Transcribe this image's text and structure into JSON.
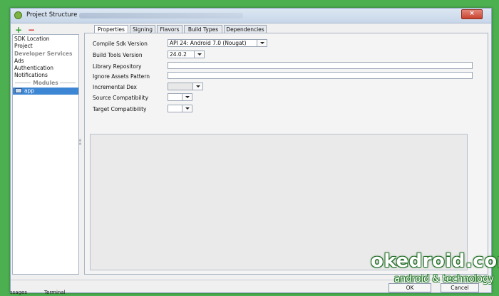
{
  "window": {
    "title": "Project Structure",
    "close_symbol": "×"
  },
  "toolbar": {
    "add_symbol": "+",
    "remove_symbol": "−"
  },
  "sidebar": {
    "items": [
      {
        "label": "SDK Location"
      },
      {
        "label": "Project"
      }
    ],
    "developer_services_header": "Developer Services",
    "developer_services": [
      {
        "label": "Ads"
      },
      {
        "label": "Authentication"
      },
      {
        "label": "Notifications"
      }
    ],
    "modules_header": "Modules",
    "modules": [
      {
        "label": "app",
        "selected": true
      }
    ]
  },
  "tabs": [
    {
      "label": "Properties",
      "active": true
    },
    {
      "label": "Signing",
      "active": false
    },
    {
      "label": "Flavors",
      "active": false
    },
    {
      "label": "Build Types",
      "active": false
    },
    {
      "label": "Dependencies",
      "active": false
    }
  ],
  "properties": {
    "compile_sdk_label": "Compile Sdk Version",
    "compile_sdk_value": "API 24: Android 7.0 (Nougat)",
    "build_tools_label": "Build Tools Version",
    "build_tools_value": "24.0.2",
    "library_repository_label": "Library Repository",
    "library_repository_value": "",
    "ignore_assets_label": "Ignore Assets Pattern",
    "ignore_assets_value": "",
    "incremental_dex_label": "Incremental Dex",
    "incremental_dex_value": "",
    "source_compat_label": "Source Compatibility",
    "source_compat_value": "",
    "target_compat_label": "Target Compatibility",
    "target_compat_value": ""
  },
  "buttons": {
    "ok": "OK",
    "cancel": "Cancel"
  },
  "statusbar": {
    "left": "ssages",
    "terminal": "Terminal"
  },
  "watermark": {
    "site": "okedroid.com",
    "tagline": "android & technology"
  },
  "colors": {
    "background": "#4caf50",
    "selection": "#3d86d3",
    "add": "#2e9d2e",
    "remove": "#d32f2f"
  }
}
